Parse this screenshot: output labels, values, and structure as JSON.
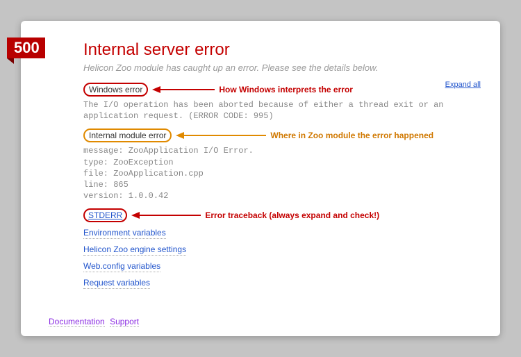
{
  "badge": "500",
  "title": "Internal server error",
  "subtitle": "Helicon Zoo module has caught up an error. Please see the details below.",
  "expand_all": "Expand all",
  "sections": {
    "windows_error": {
      "label": "Windows error",
      "note": "How Windows interprets the error",
      "body": "The I/O operation has been aborted because of either a thread exit or an application request. (ERROR CODE: 995)"
    },
    "module_error": {
      "label": "Internal module error",
      "note": "Where in Zoo module the error happened",
      "body": "message: ZooApplication I/O Error.\ntype: ZooException\nfile: ZooApplication.cpp\nline: 865\nversion: 1.0.0.42"
    },
    "stderr": {
      "label": "STDERR",
      "note": "Error traceback (always expand and check!)"
    }
  },
  "links": {
    "env": "Environment variables",
    "engine": "Helicon Zoo engine settings",
    "webconfig": "Web.config variables",
    "request": "Request variables"
  },
  "footer": {
    "doc": "Documentation",
    "support": "Support"
  }
}
